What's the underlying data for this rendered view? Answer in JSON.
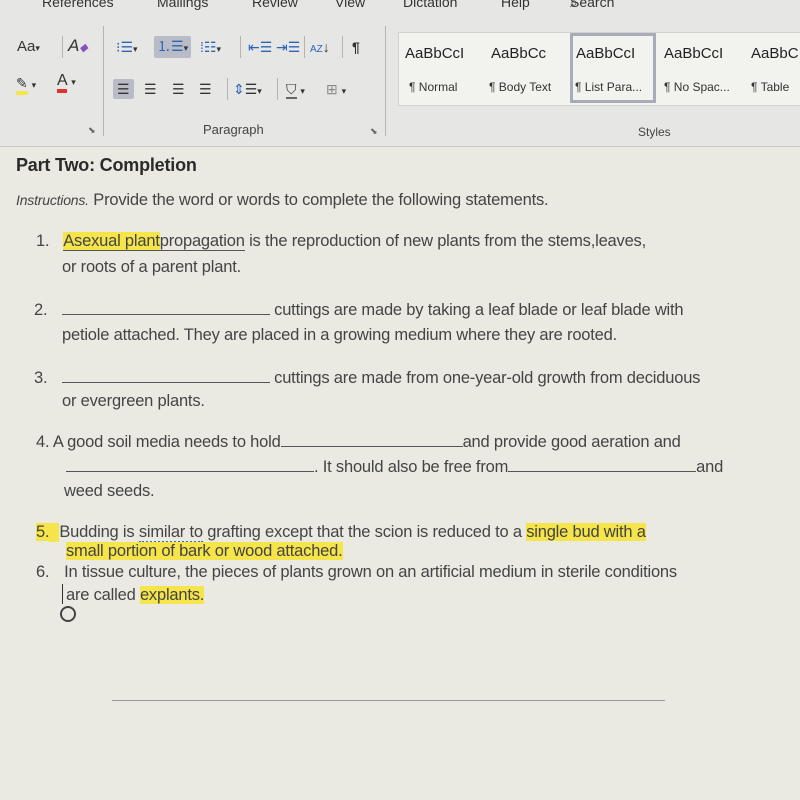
{
  "ribbon": {
    "tabs": [
      "References",
      "Mailings",
      "Review",
      "View",
      "Dictation",
      "Help"
    ],
    "search_label": "Search",
    "font_group": {
      "change_case_label": "Aa",
      "dropdown_glyph": "▾"
    },
    "paragraph_group": {
      "label": "Paragraph"
    },
    "styles_group": {
      "label": "Styles",
      "items": [
        {
          "sample": "AaBbCcI",
          "name": "¶ Normal",
          "active": false
        },
        {
          "sample": "AaBbCc",
          "name": "¶ Body Text",
          "active": false
        },
        {
          "sample": "AaBbCcI",
          "name": "¶ List Para...",
          "active": true
        },
        {
          "sample": "AaBbCcI",
          "name": "¶ No Spac...",
          "active": false
        },
        {
          "sample": "AaBbC",
          "name": "¶ Table",
          "active": false
        }
      ]
    },
    "colors": {
      "highlight": "#f5e44a",
      "font_color": "#e03030"
    }
  },
  "document": {
    "heading": "Part Two: Completion",
    "instructions_label": "Instructions.",
    "instructions_text": "Provide the word or words to complete the following statements.",
    "q1": {
      "num": "1.",
      "answer": "Asexual plant",
      "line1_rest_a": "propagation",
      "line1_rest_b": " is the reproduction of new plants from the stems,leaves,",
      "line2": "or roots of a parent plant."
    },
    "q2": {
      "num": "2.",
      "line1": "cuttings are made by taking a leaf blade or leaf blade with",
      "line2": "petiole attached. They are placed in a growing medium where they are rooted."
    },
    "q3": {
      "num": "3.",
      "line1": "cuttings are made from one-year-old growth from deciduous",
      "line2": "or evergreen plants."
    },
    "q4": {
      "num": "4.",
      "line1a": "A good soil media needs to hold",
      "line1b": "and provide good aeration and",
      "line2a": ". It should also be free from",
      "line2b": "and",
      "line3": "weed seeds."
    },
    "q5": {
      "num": "5.",
      "line1a": "Budding is ",
      "line1_spell": "similar to",
      "line1b": " grafting except that the scion is reduced to a ",
      "answer_a": "single bud with a",
      "answer_b": "small portion of bark or wood attached."
    },
    "q6": {
      "num": "6.",
      "line1": "In tissue culture, the pieces of plants grown on an artificial medium in sterile conditions",
      "line2a": "are called ",
      "answer": "explants."
    }
  }
}
